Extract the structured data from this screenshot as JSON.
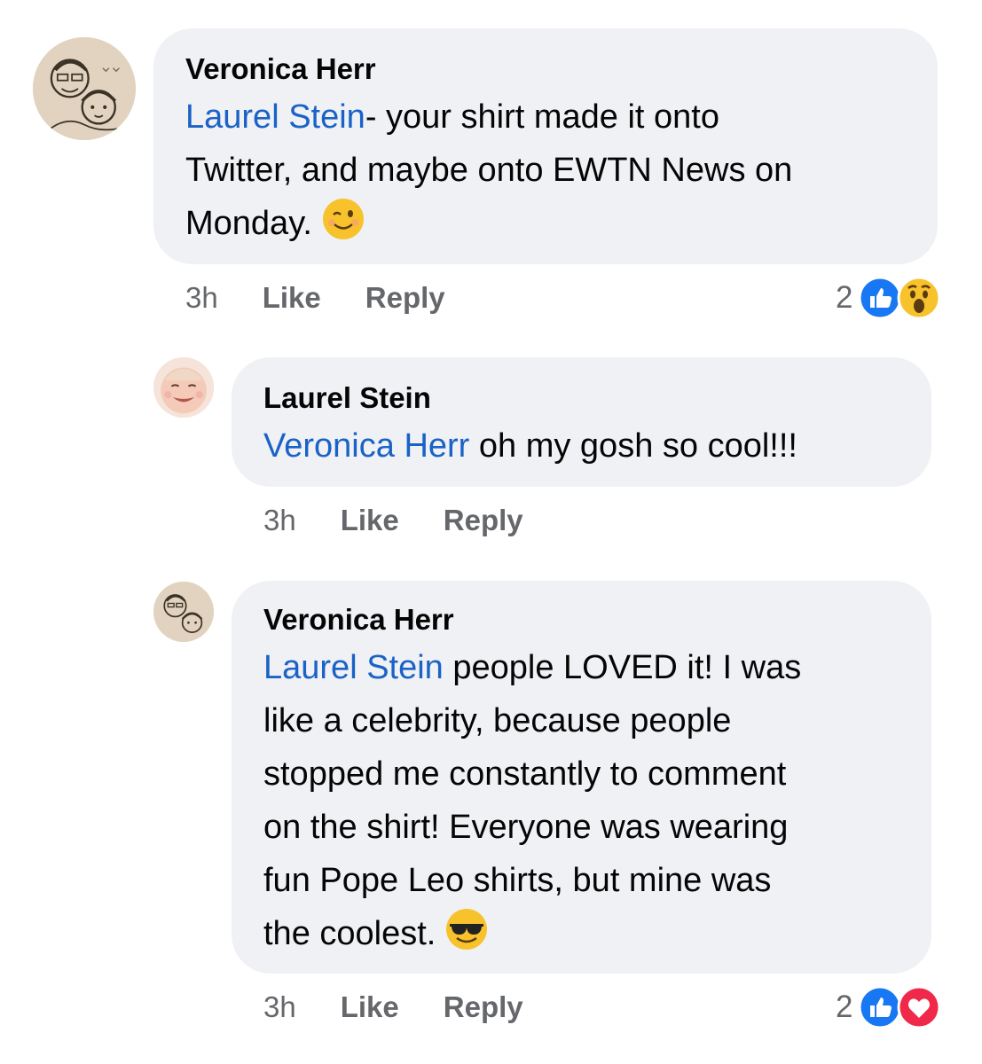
{
  "comments": [
    {
      "author": "Veronica Herr",
      "mention": "Laurel Stein",
      "text_line1": "- your shirt made it onto",
      "text_line2": "Twitter, and maybe onto EWTN News on",
      "text_line3": "Monday.",
      "emoji": "winking-face",
      "time": "3h",
      "like_label": "Like",
      "reply_label": "Reply",
      "reaction_count": "2",
      "reactions": [
        "like",
        "wow"
      ]
    },
    {
      "author": "Laurel Stein",
      "mention": "Veronica Herr",
      "text_line1": " oh my gosh so cool!!!",
      "time": "3h",
      "like_label": "Like",
      "reply_label": "Reply"
    },
    {
      "author": "Veronica Herr",
      "mention": "Laurel Stein",
      "text_line1": " people LOVED it! I was",
      "text_line2": "like a celebrity, because people",
      "text_line3": "stopped me constantly to comment",
      "text_line4": "on the shirt! Everyone was wearing",
      "text_line5": "fun Pope Leo shirts, but mine was",
      "text_line6": "the coolest.",
      "emoji": "smiling-face-with-sunglasses",
      "time": "3h",
      "like_label": "Like",
      "reply_label": "Reply",
      "reaction_count": "2",
      "reactions": [
        "like",
        "love"
      ]
    }
  ],
  "colors": {
    "bubble": "#eff1f4",
    "mention": "#1a62c6",
    "meta": "#65676b",
    "like_blue": "#1877f2",
    "love_red": "#f0284a"
  }
}
